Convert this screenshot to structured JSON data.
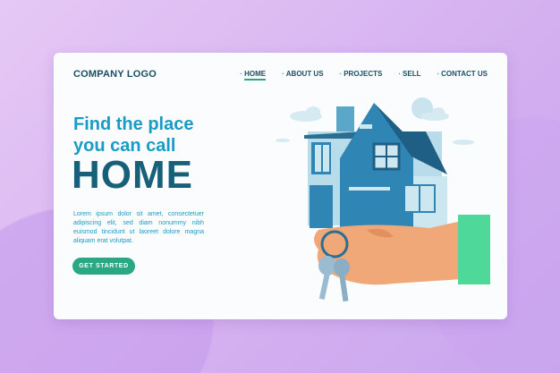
{
  "header": {
    "logo": "COMPANY LOGO",
    "nav": [
      {
        "label": "HOME",
        "active": true
      },
      {
        "label": "ABOUT US"
      },
      {
        "label": "PROJECTS"
      },
      {
        "label": "SELL"
      },
      {
        "label": "CONTACT US"
      }
    ]
  },
  "hero": {
    "line1": "Find the place",
    "line2": "you can call",
    "line3": "HOME",
    "body": "Lorem ipsum dolor sit amet, consectetuer adipiscing elit, sed diam nonummy nibh euismod tincidunt ut laoreet dolore magna aliquam erat volutpat.",
    "cta": "GET STARTED"
  },
  "colors": {
    "accent": "#2aa783",
    "primary": "#1a9bc4",
    "dark": "#17607a"
  }
}
